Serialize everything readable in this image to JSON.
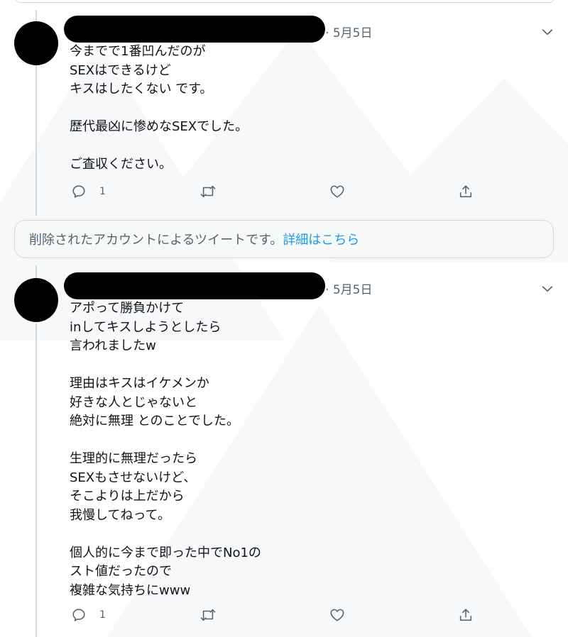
{
  "colors": {
    "text_primary": "#0f1419",
    "text_secondary": "#536471",
    "link": "#1d9bf0",
    "border": "#cfd9de",
    "notice_bg": "#f7f9f9"
  },
  "tweets": [
    {
      "author_name": "",
      "date_sep": "·",
      "date": "5月5日",
      "text": "今までで1番凹んだのが\nSEXはできるけど\nキスはしたくない です。\n\n歴代最凶に惨めなSEXでした。\n\nご査収ください。",
      "reply_count": "1",
      "retweet_count": "",
      "like_count": "",
      "icons": [
        "reply-icon",
        "retweet-icon",
        "like-icon",
        "share-icon",
        "chevron-down-icon"
      ]
    },
    {
      "author_name": "",
      "date_sep": "·",
      "date": "5月5日",
      "text": "アポって勝負かけて\ninしてキスしようとしたら\n言われましたw\n\n理由はキスはイケメンか\n好きな人とじゃないと\n絶対に無理 とのことでした。\n\n生理的に無理だったら\nSEXもさせないけど、\nそこよりは上だから\n我慢してねって。\n\n個人的に今まで即った中でNo1の\nスト値だったので\n複雑な気持ちにwww",
      "reply_count": "1",
      "retweet_count": "",
      "like_count": "",
      "icons": [
        "reply-icon",
        "retweet-icon",
        "like-icon",
        "share-icon",
        "chevron-down-icon"
      ]
    }
  ],
  "deleted_notice": {
    "text": "削除されたアカウントによるツイートです。",
    "link_label": "詳細はこちら"
  }
}
